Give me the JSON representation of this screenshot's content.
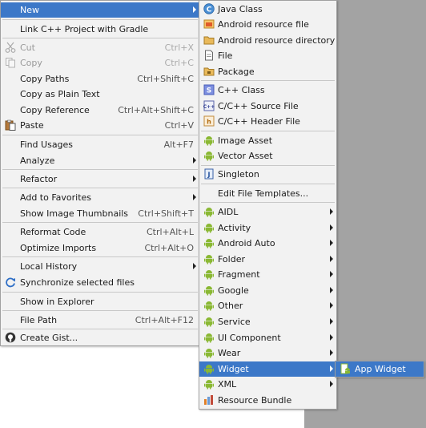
{
  "colors": {
    "highlight": "#3c78c8",
    "menu_bg": "#f2f2f2",
    "android_green": "#8ab833"
  },
  "main_menu": {
    "new": {
      "label": "New",
      "icon": "none"
    },
    "link_cpp": {
      "label": "Link C++ Project with Gradle"
    },
    "cut": {
      "label": "Cut",
      "shortcut": "Ctrl+X",
      "icon": "scissors-icon"
    },
    "copy": {
      "label": "Copy",
      "shortcut": "Ctrl+C",
      "icon": "copy-icon"
    },
    "copy_paths": {
      "label": "Copy Paths",
      "shortcut": "Ctrl+Shift+C"
    },
    "copy_plain": {
      "label": "Copy as Plain Text"
    },
    "copy_reference": {
      "label": "Copy Reference",
      "shortcut": "Ctrl+Alt+Shift+C"
    },
    "paste": {
      "label": "Paste",
      "shortcut": "Ctrl+V",
      "icon": "paste-icon"
    },
    "find_usages": {
      "label": "Find Usages",
      "shortcut": "Alt+F7"
    },
    "analyze": {
      "label": "Analyze"
    },
    "refactor": {
      "label": "Refactor"
    },
    "add_favorites": {
      "label": "Add to Favorites"
    },
    "show_thumbnails": {
      "label": "Show Image Thumbnails",
      "shortcut": "Ctrl+Shift+T"
    },
    "reformat": {
      "label": "Reformat Code",
      "shortcut": "Ctrl+Alt+L"
    },
    "optimize_imports": {
      "label": "Optimize Imports",
      "shortcut": "Ctrl+Alt+O"
    },
    "local_history": {
      "label": "Local History"
    },
    "synchronize": {
      "label": "Synchronize selected files",
      "icon": "sync-icon"
    },
    "show_explorer": {
      "label": "Show in Explorer"
    },
    "file_path": {
      "label": "File Path",
      "shortcut": "Ctrl+Alt+F12"
    },
    "create_gist": {
      "label": "Create Gist...",
      "icon": "github-icon"
    }
  },
  "new_menu": {
    "java_class": {
      "label": "Java Class",
      "icon": "java-class-icon"
    },
    "android_resource_file": {
      "label": "Android resource file",
      "icon": "resource-file-icon"
    },
    "android_resource_dir": {
      "label": "Android resource directory",
      "icon": "folder-icon"
    },
    "file": {
      "label": "File",
      "icon": "file-icon"
    },
    "package": {
      "label": "Package",
      "icon": "package-icon"
    },
    "cpp_class": {
      "label": "C++ Class",
      "icon": "cpp-class-icon"
    },
    "cpp_source": {
      "label": "C/C++ Source File",
      "icon": "cpp-source-icon"
    },
    "cpp_header": {
      "label": "C/C++ Header File",
      "icon": "cpp-header-icon"
    },
    "image_asset": {
      "label": "Image Asset",
      "icon": "android-icon"
    },
    "vector_asset": {
      "label": "Vector Asset",
      "icon": "android-icon"
    },
    "singleton": {
      "label": "Singleton",
      "icon": "singleton-icon"
    },
    "edit_templates": {
      "label": "Edit File Templates..."
    },
    "aidl": {
      "label": "AIDL",
      "icon": "android-icon"
    },
    "activity": {
      "label": "Activity",
      "icon": "android-icon"
    },
    "android_auto": {
      "label": "Android Auto",
      "icon": "android-icon"
    },
    "folder": {
      "label": "Folder",
      "icon": "android-icon"
    },
    "fragment": {
      "label": "Fragment",
      "icon": "android-icon"
    },
    "google": {
      "label": "Google",
      "icon": "android-icon"
    },
    "other": {
      "label": "Other",
      "icon": "android-icon"
    },
    "service": {
      "label": "Service",
      "icon": "android-icon"
    },
    "ui_component": {
      "label": "UI Component",
      "icon": "android-icon"
    },
    "wear": {
      "label": "Wear",
      "icon": "android-icon"
    },
    "widget": {
      "label": "Widget",
      "icon": "android-icon"
    },
    "xml": {
      "label": "XML",
      "icon": "android-icon"
    },
    "resource_bundle": {
      "label": "Resource Bundle",
      "icon": "resource-bundle-icon"
    }
  },
  "widget_menu": {
    "app_widget": {
      "label": "App Widget",
      "icon": "app-widget-icon"
    }
  }
}
